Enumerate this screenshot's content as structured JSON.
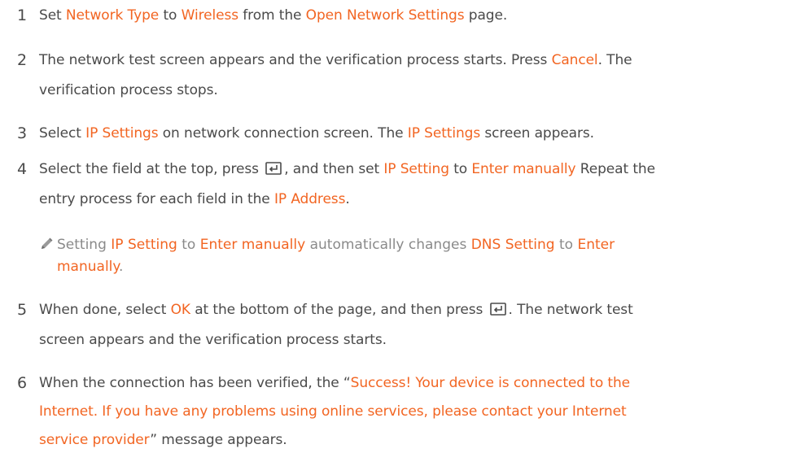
{
  "steps": [
    {
      "num": "1",
      "parts": [
        {
          "t": "Set "
        },
        {
          "t": "Network Type",
          "hl": true
        },
        {
          "t": " to "
        },
        {
          "t": "Wireless",
          "hl": true
        },
        {
          "t": " from the "
        },
        {
          "t": "Open Network Settings",
          "hl": true
        },
        {
          "t": " page."
        }
      ]
    },
    {
      "num": "2",
      "line1": [
        {
          "t": "The network test screen appears and the verification process starts. Press "
        },
        {
          "t": "Cancel",
          "hl": true
        },
        {
          "t": ". The"
        }
      ],
      "line2": [
        {
          "t": "verification process stops."
        }
      ]
    },
    {
      "num": "3",
      "parts": [
        {
          "t": "Select "
        },
        {
          "t": "IP Settings",
          "hl": true
        },
        {
          "t": " on network connection screen. The "
        },
        {
          "t": "IP Settings",
          "hl": true
        },
        {
          "t": " screen appears."
        }
      ]
    },
    {
      "num": "4",
      "line1": [
        {
          "t": "Select the field at the top, press "
        },
        {
          "icon": "enter-icon"
        },
        {
          "t": ", and then set "
        },
        {
          "t": "IP Setting",
          "hl": true
        },
        {
          "t": " to "
        },
        {
          "t": "Enter manually",
          "hl": true
        },
        {
          "t": " Repeat the"
        }
      ],
      "line2": [
        {
          "t": "entry process for each field in the "
        },
        {
          "t": "IP Address",
          "hl": true
        },
        {
          "t": "."
        }
      ]
    },
    {
      "num": "5",
      "line1": [
        {
          "t": "When done, select "
        },
        {
          "t": "OK",
          "hl": true
        },
        {
          "t": " at the bottom of the page, and then press "
        },
        {
          "icon": "enter-icon"
        },
        {
          "t": ". The network test"
        }
      ],
      "line2": [
        {
          "t": "screen appears and the verification process starts."
        }
      ]
    },
    {
      "num": "6",
      "line1": [
        {
          "t": "When the connection has been verified, the “"
        },
        {
          "t": "Success! Your device is connected to the",
          "hl": true
        }
      ],
      "line2": [
        {
          "t": "Internet. If you have any problems using online services, please contact your Internet",
          "hl": true
        }
      ],
      "line3": [
        {
          "t": "service provider",
          "hl": true
        },
        {
          "t": "” message appears."
        }
      ]
    }
  ],
  "note": {
    "icon": "pencil-icon",
    "line1": [
      {
        "t": "Setting "
      },
      {
        "t": "IP Setting",
        "hl": true
      },
      {
        "t": " to "
      },
      {
        "t": "Enter manually",
        "hl": true
      },
      {
        "t": " automatically changes "
      },
      {
        "t": "DNS Setting",
        "hl": true
      },
      {
        "t": " to "
      },
      {
        "t": "Enter",
        "hl": true
      }
    ],
    "line2": [
      {
        "t": "manually",
        "hl": true
      },
      {
        "t": "."
      }
    ]
  },
  "colors": {
    "text": "#4a4a4a",
    "highlight": "#f26522",
    "note_text": "#8a8a8a"
  }
}
